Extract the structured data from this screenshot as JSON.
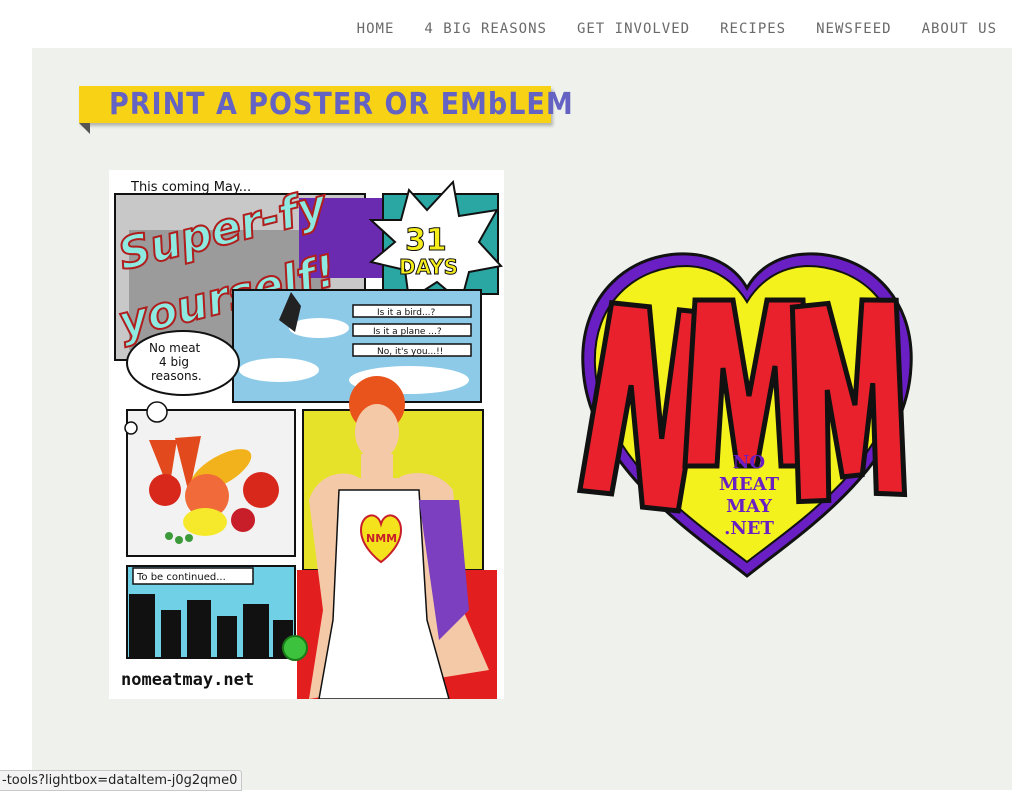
{
  "nav": {
    "items": [
      "HOME",
      "4 BIG REASONS",
      "GET INVOLVED",
      "RECIPES",
      "NEWSFEED",
      "ABOUT US"
    ]
  },
  "page": {
    "title": "PRINT A POSTER OR EMbLEM"
  },
  "poster": {
    "top_text": "This coming May...",
    "headline_1": "Super-fy",
    "headline_2": "yourself!",
    "days_num": "31",
    "days_word": "DAYS",
    "bird": "Is it a bird...?",
    "plane": "Is it a plane ...?",
    "you": "No, it's you...!!",
    "reasons_1": "No meat",
    "reasons_2": "4 big",
    "reasons_3": "reasons.",
    "continued": "To be continued...",
    "url": "nomeatmay.net",
    "chest_logo": "NMM"
  },
  "emblem": {
    "letters": "NMM",
    "line1": "NO",
    "line2": "MEAT",
    "line3": "MAY",
    "line4": ".NET"
  },
  "status_bar": {
    "url": "-tools?lightbox=dataItem-j0g2qme0"
  },
  "colors": {
    "nav_text": "#6a6a6a",
    "panel_bg": "#eff2ec",
    "banner_bg": "#f7d215",
    "banner_text": "#6463c4",
    "emblem_red": "#e8212d",
    "emblem_yellow": "#f4f21c",
    "emblem_purple": "#6a1fc4"
  }
}
